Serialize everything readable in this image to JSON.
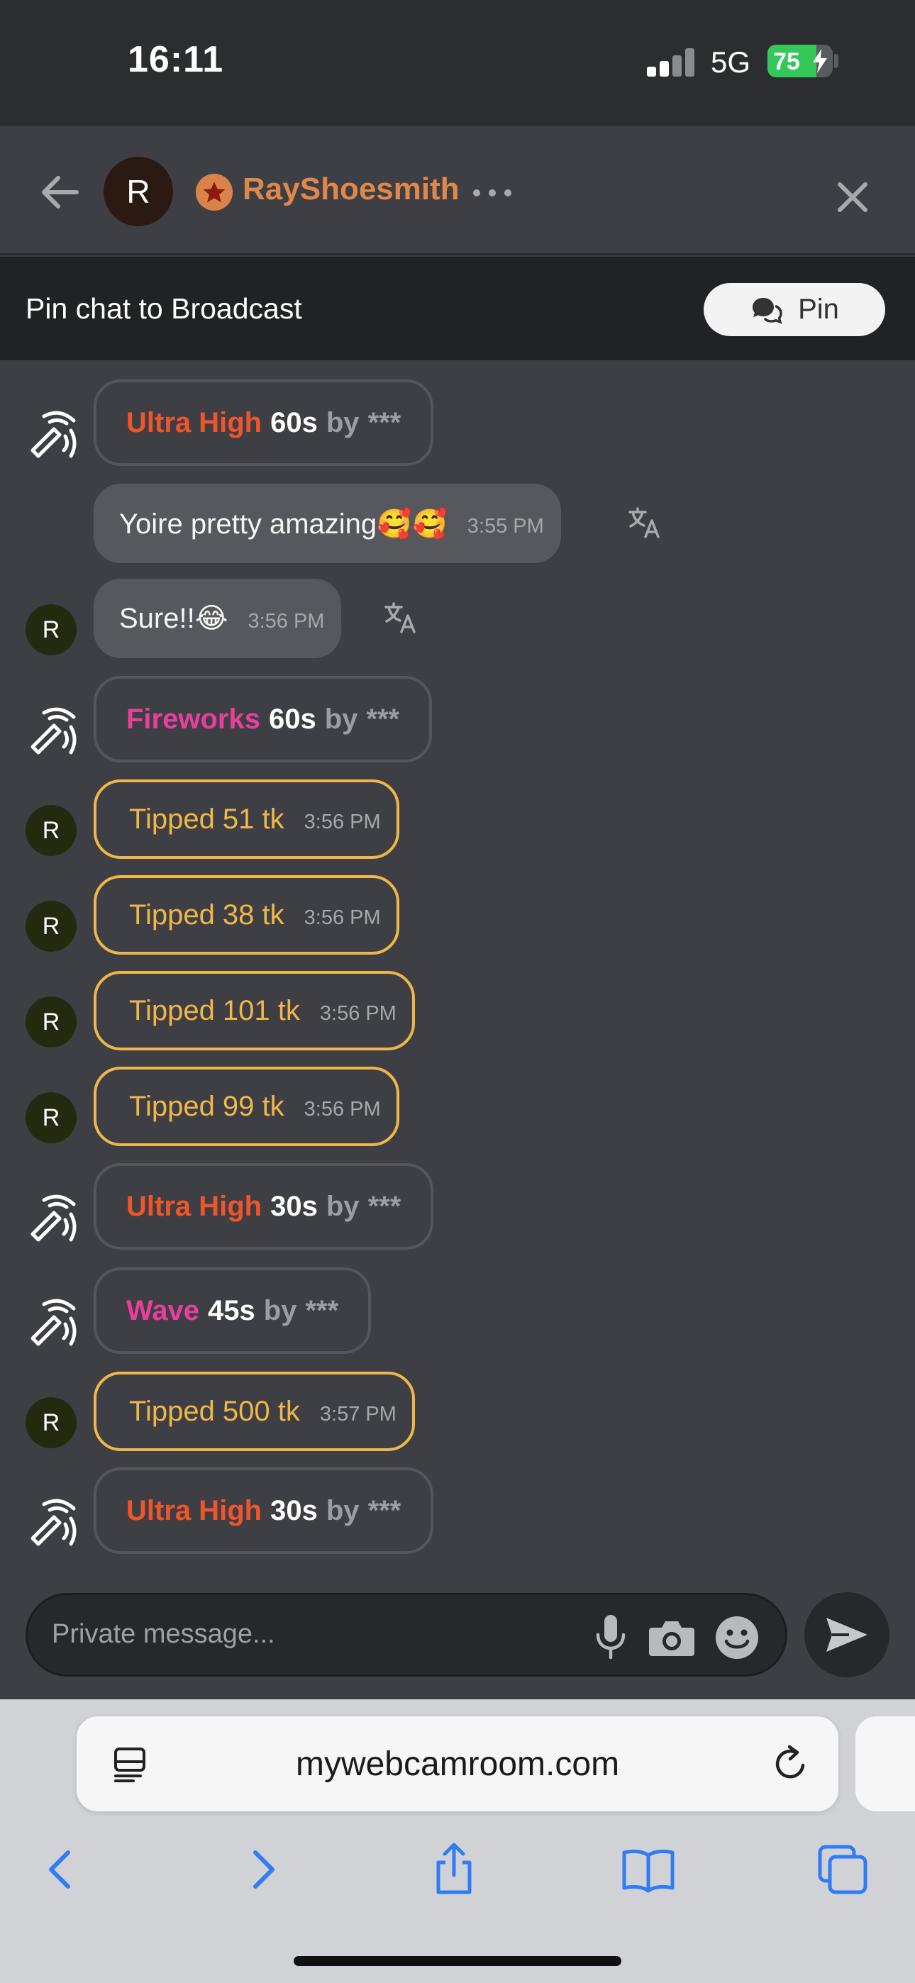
{
  "status_bar": {
    "time": "16:11",
    "network": "5G",
    "battery": "75",
    "battery_level": 0.75
  },
  "header": {
    "avatar_initial": "R",
    "username": "RayShoesmith"
  },
  "pin_bar": {
    "text": "Pin chat to Broadcast",
    "button_label": "Pin"
  },
  "messages": {
    "m1": {
      "name": "Ultra High",
      "name_color": "#f0552a",
      "duration": "60s",
      "by": "by",
      "user": "***"
    },
    "m2": {
      "text": "Yoire pretty amazing🥰🥰",
      "time": "3:55 PM"
    },
    "m3": {
      "avatar": "R",
      "text": "Sure!!😂",
      "time": "3:56 PM"
    },
    "m4": {
      "name": "Fireworks",
      "name_color": "#e8409a",
      "duration": "60s",
      "by": "by",
      "user": "***"
    },
    "m5": {
      "avatar": "R",
      "text": "Tipped 51 tk",
      "time": "3:56 PM"
    },
    "m6": {
      "avatar": "R",
      "text": "Tipped 38 tk",
      "time": "3:56 PM"
    },
    "m7": {
      "avatar": "R",
      "text": "Tipped 101 tk",
      "time": "3:56 PM"
    },
    "m8": {
      "avatar": "R",
      "text": "Tipped 99 tk",
      "time": "3:56 PM"
    },
    "m9": {
      "name": "Ultra High",
      "name_color": "#f0552a",
      "duration": "30s",
      "by": "by",
      "user": "***"
    },
    "m10": {
      "name": "Wave",
      "name_color": "#e8409a",
      "duration": "45s",
      "by": "by",
      "user": "***"
    },
    "m11": {
      "avatar": "R",
      "text": "Tipped 500 tk",
      "time": "3:57 PM"
    },
    "m12": {
      "name": "Ultra High",
      "name_color": "#f0552a",
      "duration": "30s",
      "by": "by",
      "user": "***"
    }
  },
  "composer": {
    "placeholder": "Private message..."
  },
  "browser": {
    "url": "mywebcamroom.com"
  },
  "colors": {
    "tip_accent": "#f0b64a",
    "username_accent": "#e0874b"
  }
}
